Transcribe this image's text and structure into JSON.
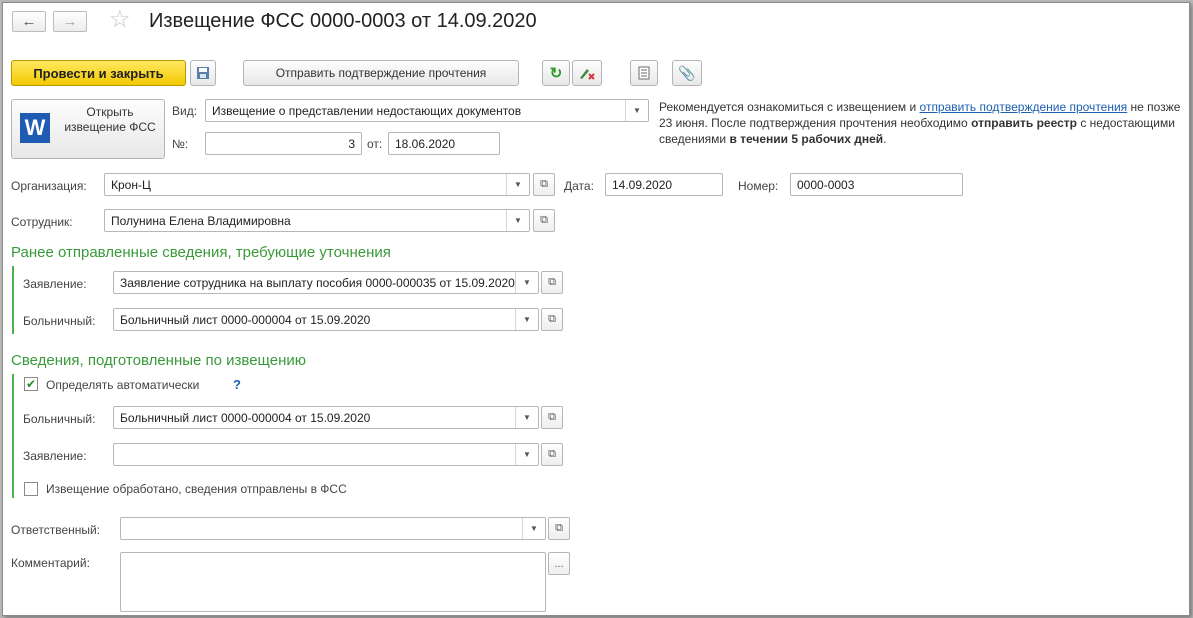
{
  "title": "Извещение ФСС 0000-0003 от 14.09.2020",
  "nav": {
    "back": "←",
    "forward": "→",
    "star": "☆"
  },
  "toolbar": {
    "post_close": "Провести и закрыть",
    "send_confirm": "Отправить подтверждение прочтения"
  },
  "open_notice": {
    "icon_letter": "W",
    "label": "Открыть извещение ФСС"
  },
  "kind": {
    "label": "Вид:",
    "value": "Извещение о представлении недостающих документов"
  },
  "number_row": {
    "label": "№:",
    "value": "3",
    "from_label": "от:",
    "from_value": "18.06.2020"
  },
  "info": {
    "t1": "Рекомендуется ознакомиться с извещением и ",
    "link": "отправить подтверждение прочтения",
    "t2": " не позже 23 июня. После подтверждения прочтения необходимо ",
    "b1": "отправить реестр",
    "t3": " с недостающими сведениями ",
    "b2": "в течении 5 рабочих дней",
    "t4": "."
  },
  "org": {
    "label": "Организация:",
    "value": "Крон-Ц"
  },
  "date": {
    "label": "Дата:",
    "value": "14.09.2020"
  },
  "number": {
    "label": "Номер:",
    "value": "0000-0003"
  },
  "employee": {
    "label": "Сотрудник:",
    "value": "Полунина Елена Владимировна"
  },
  "section1": {
    "title": "Ранее отправленные сведения, требующие уточнения",
    "app_label": "Заявление:",
    "app_value": "Заявление сотрудника на выплату пособия 0000-000035 от 15.09.2020",
    "sick_label": "Больничный:",
    "sick_value": "Больничный лист 0000-000004 от 15.09.2020"
  },
  "section2": {
    "title": "Сведения, подготовленные по извещению",
    "auto_label": "Определять автоматически",
    "help": "?",
    "sick_label": "Больничный:",
    "sick_value": "Больничный лист 0000-000004 от 15.09.2020",
    "app_label": "Заявление:",
    "app_value": "",
    "processed_label": "Извещение обработано, сведения отправлены в ФСС"
  },
  "responsible": {
    "label": "Ответственный:",
    "value": ""
  },
  "comment": {
    "label": "Комментарий:",
    "value": "",
    "more": "..."
  },
  "colors": {
    "accent_green": "#3a9a3a",
    "primary_yellow": "#f3c900",
    "link_blue": "#1c5fb0"
  }
}
